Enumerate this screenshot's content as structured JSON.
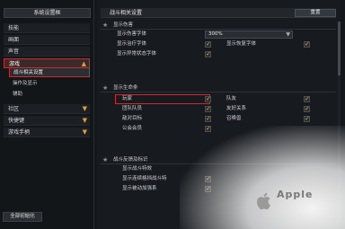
{
  "left": {
    "header": "系统设置框",
    "items": [
      {
        "label": "技能"
      },
      {
        "label": "画面"
      },
      {
        "label": "声音"
      },
      {
        "label": "游戏",
        "submenu": [
          "战斗相关设置"
        ]
      },
      {
        "label": "操作及显示"
      },
      {
        "label": "辅助"
      },
      {
        "label": "社区"
      },
      {
        "label": "快捷键"
      },
      {
        "label": "游戏手柄"
      }
    ],
    "reset_all": "全部初始化"
  },
  "main": {
    "title": "战斗相关设置",
    "reset": "重置",
    "sections": [
      {
        "title": "显示伤害",
        "rows": [
          {
            "left_label": "显示伤害字体",
            "dropdown": "300%"
          },
          {
            "left_label": "显示治疗字体",
            "left_checked": true,
            "right_label": "显示恢复字体",
            "right_checked": true
          },
          {
            "left_label": "显示异常状态字体",
            "left_checked": true
          }
        ]
      },
      {
        "title": "显示生命条",
        "rows": [
          {
            "left_label": "玩家",
            "left_checked": true,
            "right_label": "队友",
            "right_checked": true
          },
          {
            "left_label": "团队队员",
            "left_checked": true,
            "right_label": "友好关系",
            "right_checked": true
          },
          {
            "left_label": "敌对目标",
            "left_checked": true,
            "right_label": "召唤兽",
            "right_checked": true
          },
          {
            "left_label": "公会会员",
            "left_checked": true
          }
        ]
      },
      {
        "title": "战斗反馈及标识",
        "rows": [
          {
            "left_label": "显示战斗特效"
          },
          {
            "left_label": "显示连续格挡战斗特",
            "left_checked": true
          },
          {
            "left_label": "显示被动加强系",
            "left_checked": true
          }
        ]
      }
    ]
  },
  "watermark": "Apple"
}
